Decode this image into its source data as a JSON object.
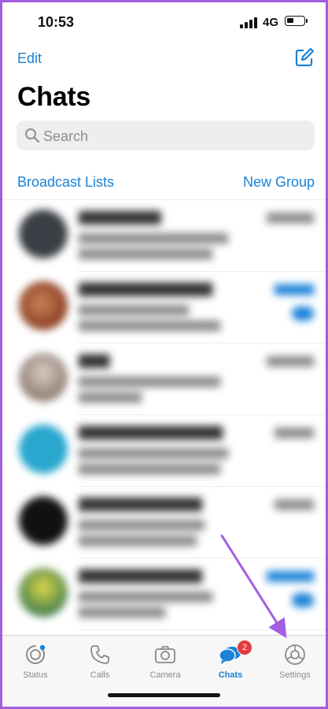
{
  "status_bar": {
    "time": "10:53",
    "network": "4G"
  },
  "header": {
    "edit_label": "Edit",
    "title": "Chats"
  },
  "search": {
    "placeholder": "Search"
  },
  "links": {
    "broadcast": "Broadcast Lists",
    "new_group": "New Group"
  },
  "tabs": [
    {
      "label": "Status",
      "icon": "status-icon"
    },
    {
      "label": "Calls",
      "icon": "phone-icon"
    },
    {
      "label": "Camera",
      "icon": "camera-icon"
    },
    {
      "label": "Chats",
      "icon": "chat-bubbles-icon",
      "badge": "2"
    },
    {
      "label": "Settings",
      "icon": "gear-icon"
    }
  ],
  "colors": {
    "accent": "#1a82d8",
    "badge": "#e33b3b",
    "annotation": "#a35ee0"
  }
}
